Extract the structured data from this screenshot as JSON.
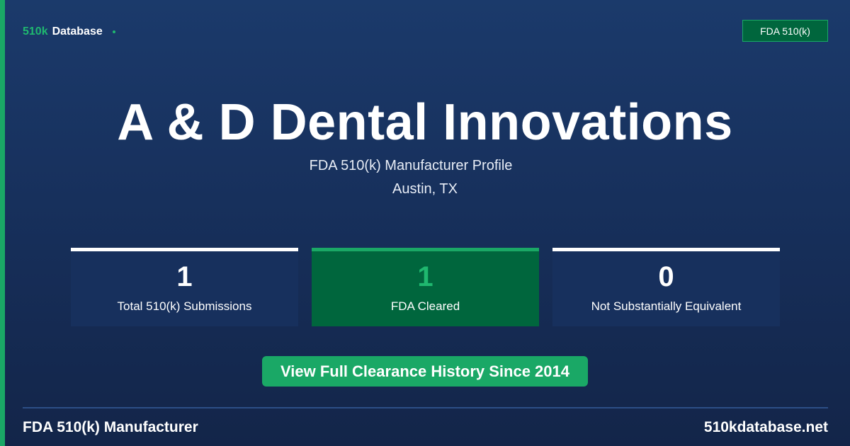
{
  "header": {
    "brand_key": "510k",
    "brand_rest": "Database",
    "badge": "FDA 510(k)"
  },
  "hero": {
    "title": "A & D Dental Innovations",
    "subtitle": "FDA 510(k) Manufacturer Profile",
    "location": "Austin, TX"
  },
  "stats": [
    {
      "value": "1",
      "label": "Total 510(k) Submissions"
    },
    {
      "value": "1",
      "label": "FDA Cleared"
    },
    {
      "value": "0",
      "label": "Not Substantially Equivalent"
    }
  ],
  "cta": {
    "label": "View Full Clearance History Since 2014"
  },
  "footer": {
    "left": "FDA 510(k) Manufacturer",
    "right": "510kdatabase.net"
  },
  "colors": {
    "background": "#1b3a6b",
    "accent": "#1aa866",
    "cleared_card": "#00663d"
  }
}
